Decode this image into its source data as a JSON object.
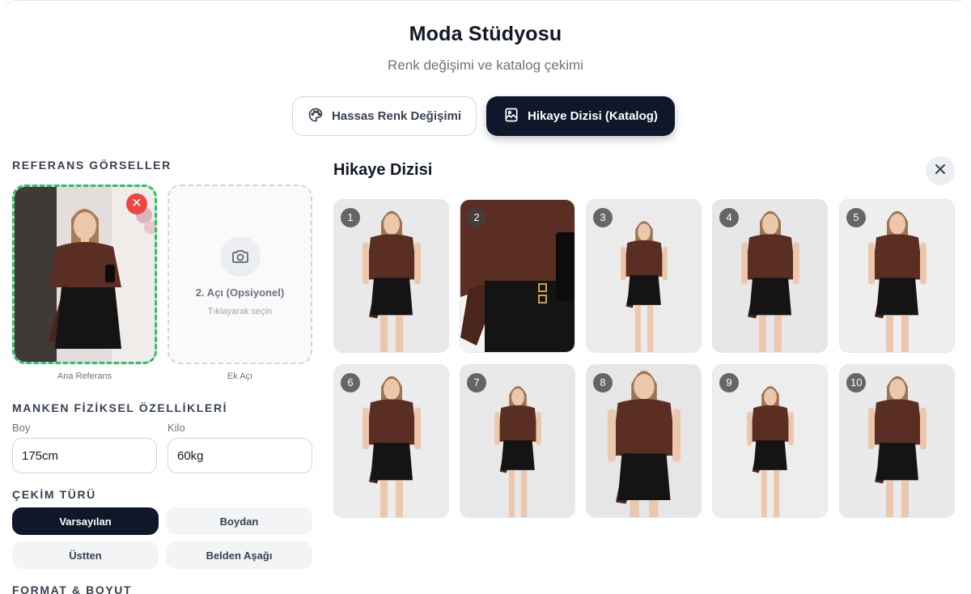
{
  "header": {
    "title": "Moda Stüdyosu",
    "subtitle": "Renk değişimi ve katalog çekimi"
  },
  "mode_tabs": [
    {
      "label": "Hassas Renk Değişimi",
      "icon": "palette-icon",
      "active": false
    },
    {
      "label": "Hikaye Dizisi (Katalog)",
      "icon": "image-gallery-icon",
      "active": true
    }
  ],
  "references": {
    "section_label": "REFERANS GÖRSELLER",
    "main_caption": "Ana Referans",
    "extra_title": "2. Açı (Opsiyonel)",
    "extra_hint": "Tıklayarak seçin",
    "extra_caption": "Ek Açı"
  },
  "physical": {
    "section_label": "MANKEN FİZİKSEL ÖZELLİKLERİ",
    "height_label": "Boy",
    "height_value": "175cm",
    "weight_label": "Kilo",
    "weight_value": "60kg"
  },
  "shot_type": {
    "section_label": "ÇEKİM TÜRÜ",
    "options": [
      {
        "label": "Varsayılan",
        "selected": true
      },
      {
        "label": "Boydan",
        "selected": false
      },
      {
        "label": "Üstten",
        "selected": false
      },
      {
        "label": "Belden Aşağı",
        "selected": false
      }
    ]
  },
  "format": {
    "section_label": "FORMAT & BOYUT"
  },
  "story": {
    "title": "Hikaye Dizisi",
    "thumbnails": [
      "1",
      "2",
      "3",
      "4",
      "5",
      "6",
      "7",
      "8",
      "9",
      "10"
    ]
  },
  "colors": {
    "primary_dark": "#0f172a",
    "top_brown": "#5a2e22",
    "skirt_black": "#141414",
    "accent_green": "#22c55e",
    "remove_red": "#ef4444"
  }
}
